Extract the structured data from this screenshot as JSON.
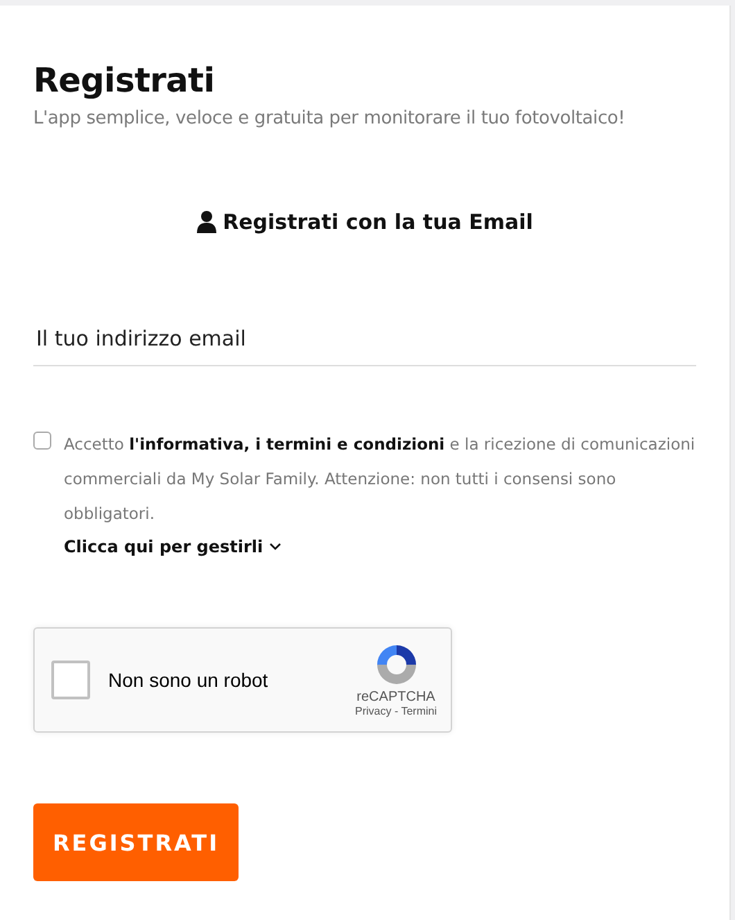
{
  "title": "Registrati",
  "subtitle": "L'app semplice, veloce e gratuita per monitorare il tuo fotovoltaico!",
  "section_heading": "Registrati con la tua Email",
  "email": {
    "placeholder": "Il tuo indirizzo email"
  },
  "consent": {
    "checked": false,
    "text": "Accetto **l'informativa, i termini e condizioni** e la ricezione di comunicazioni commerciali da My Solar Family. Attenzione: non tutti i consensi sono obbligatori.",
    "manage_link": "Clicca qui per gestirli"
  },
  "captcha": {
    "checked": false,
    "label": "Non sono un robot",
    "brand": "reCAPTCHA",
    "links": "Privacy - Termini"
  },
  "submit_button": "REGISTRATI"
}
